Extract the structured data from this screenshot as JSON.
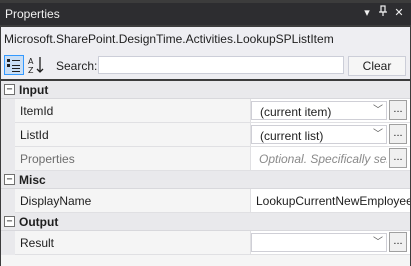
{
  "window": {
    "title": "Properties",
    "controls": [
      "▾",
      "🖈",
      "✕"
    ]
  },
  "type_name": "Microsoft.SharePoint.DesignTime.Activities.LookupSPListItem",
  "toolbar": {
    "categorized_icon": "categorized-icon",
    "alphabetical_icon": "sort-az-icon",
    "search_label": "Search:",
    "search_value": "",
    "clear_label": "Clear"
  },
  "categories": {
    "input": {
      "label": "Input",
      "toggle": "−",
      "props": [
        {
          "name": "ItemId",
          "value": "(current item)",
          "has_dropdown": true,
          "has_ellipsis": true
        },
        {
          "name": "ListId",
          "value": "(current list)",
          "has_dropdown": true,
          "has_ellipsis": true
        },
        {
          "name": "Properties",
          "placeholder": "Optional. Specifically sele",
          "has_ellipsis": true
        }
      ]
    },
    "misc": {
      "label": "Misc",
      "toggle": "−",
      "props": [
        {
          "name": "DisplayName",
          "value": "LookupCurrentNewEmployee"
        }
      ]
    },
    "output": {
      "label": "Output",
      "toggle": "−",
      "props": [
        {
          "name": "Result",
          "value": "",
          "has_dropdown": true,
          "has_ellipsis": true
        }
      ]
    }
  },
  "ellipsis_label": "...",
  "dropdown_icon": "chevron-down-icon"
}
